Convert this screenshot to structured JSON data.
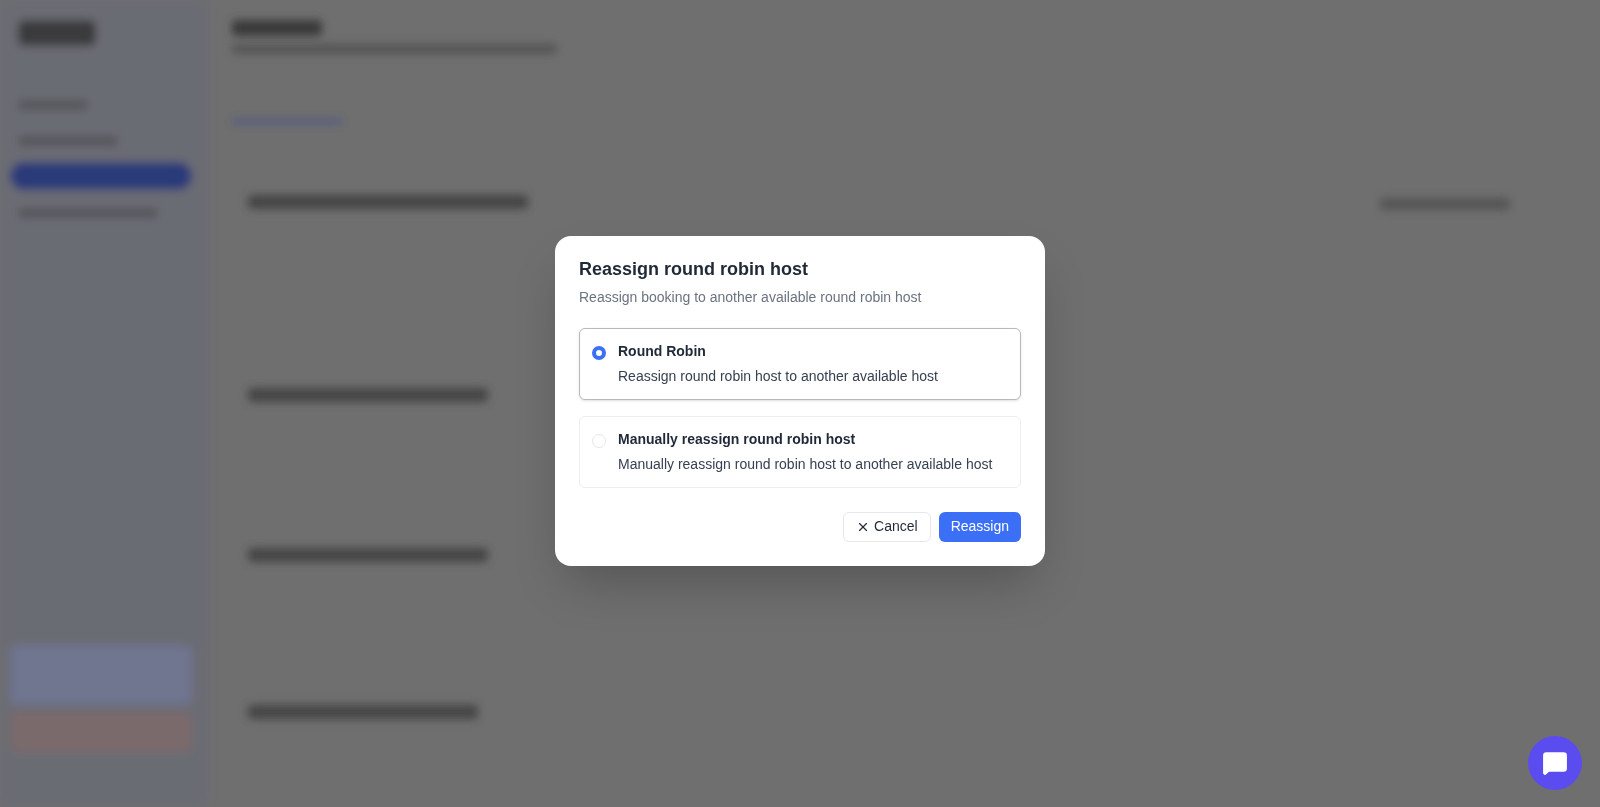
{
  "dialog": {
    "title": "Reassign round robin host",
    "description": "Reassign booking to another available round robin host",
    "options": [
      {
        "label": "Round Robin",
        "description": "Reassign round robin host to another available host",
        "selected": true
      },
      {
        "label": "Manually reassign round robin host",
        "description": "Manually reassign round robin host to another available host",
        "selected": false
      }
    ],
    "cancel": "Cancel",
    "confirm": "Reassign"
  }
}
